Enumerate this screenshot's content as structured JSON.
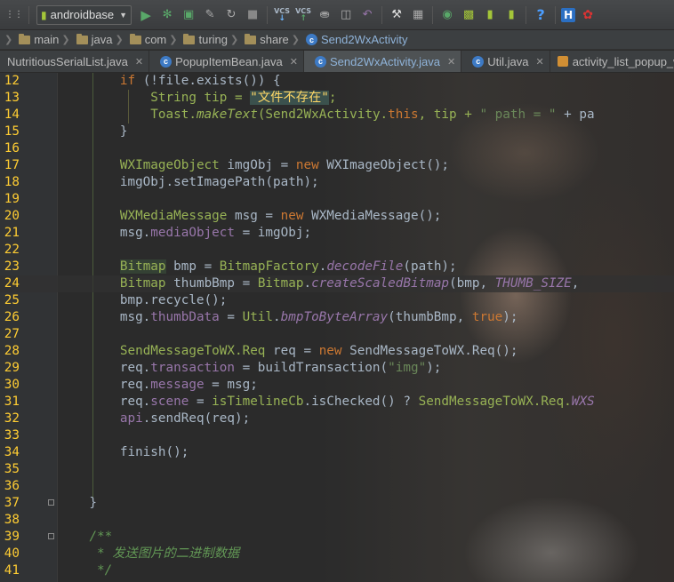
{
  "toolbar": {
    "config_name": "androidbase",
    "vcs_label_1": "VCS",
    "vcs_label_2": "VCS"
  },
  "breadcrumb": [
    "main",
    "java",
    "com",
    "turing",
    "share",
    "Send2WxActivity"
  ],
  "tabs": [
    {
      "label": "NutritiousSerialList.java",
      "active": false,
      "icon": "class-icon"
    },
    {
      "label": "PopupItemBean.java",
      "active": false,
      "icon": "class-icon"
    },
    {
      "label": "Send2WxActivity.java",
      "active": true,
      "icon": "class-icon"
    },
    {
      "label": "Util.java",
      "active": false,
      "icon": "class-icon"
    },
    {
      "label": "activity_list_popup_win",
      "active": false,
      "icon": "xml-layout-icon"
    }
  ],
  "editor": {
    "current_line": "24",
    "lines": [
      {
        "n": "12",
        "tokens": [
          [
            "        ",
            ""
          ],
          [
            "if",
            "k"
          ],
          [
            " (!file.exists()) {",
            ""
          ]
        ]
      },
      {
        "n": "13",
        "tokens": [
          [
            "            ",
            ""
          ],
          [
            "String",
            "g"
          ],
          [
            " tip = ",
            "g"
          ],
          [
            "\"文件不存在\"",
            "sh"
          ],
          [
            ";",
            "g"
          ]
        ]
      },
      {
        "n": "14",
        "tokens": [
          [
            "            ",
            ""
          ],
          [
            "Toast.",
            "g"
          ],
          [
            "makeText",
            "g it"
          ],
          [
            "(Send2WxActivity.",
            "g"
          ],
          [
            "this",
            "k"
          ],
          [
            ", tip + ",
            "g"
          ],
          [
            "\" path = \"",
            "s"
          ],
          [
            " + pa",
            ""
          ]
        ]
      },
      {
        "n": "15",
        "tokens": [
          [
            "        }",
            ""
          ]
        ]
      },
      {
        "n": "16",
        "tokens": [
          [
            "",
            ""
          ]
        ]
      },
      {
        "n": "17",
        "tokens": [
          [
            "        ",
            ""
          ],
          [
            "WXImageObject",
            "g"
          ],
          [
            " imgObj = ",
            ""
          ],
          [
            "new",
            "k"
          ],
          [
            " WXImageObject();",
            ""
          ]
        ]
      },
      {
        "n": "18",
        "tokens": [
          [
            "        imgObj.setImagePath(path);",
            ""
          ]
        ]
      },
      {
        "n": "19",
        "tokens": [
          [
            "",
            ""
          ]
        ]
      },
      {
        "n": "20",
        "tokens": [
          [
            "        ",
            ""
          ],
          [
            "WXMediaMessage",
            "g"
          ],
          [
            " msg = ",
            ""
          ],
          [
            "new",
            "k"
          ],
          [
            " WXMediaMessage();",
            ""
          ]
        ]
      },
      {
        "n": "21",
        "tokens": [
          [
            "        msg.",
            ""
          ],
          [
            "mediaObject",
            "p"
          ],
          [
            " = imgObj;",
            ""
          ]
        ]
      },
      {
        "n": "22",
        "tokens": [
          [
            "",
            ""
          ]
        ]
      },
      {
        "n": "23",
        "tokens": [
          [
            "        ",
            ""
          ],
          [
            "Bitmap",
            "g hl"
          ],
          [
            " bmp = ",
            ""
          ],
          [
            "BitmapFactory",
            "g"
          ],
          [
            ".",
            ""
          ],
          [
            "decodeFile",
            "pu it"
          ],
          [
            "(path);",
            ""
          ]
        ]
      },
      {
        "n": "24",
        "tokens": [
          [
            "        ",
            ""
          ],
          [
            "Bitmap",
            "g"
          ],
          [
            " thumbBmp = ",
            ""
          ],
          [
            "Bitmap",
            "g"
          ],
          [
            ".",
            ""
          ],
          [
            "createScaledBitmap",
            "pu it"
          ],
          [
            "(bmp, ",
            ""
          ],
          [
            "THUMB_SIZE",
            "pu it"
          ],
          [
            ",",
            ""
          ]
        ]
      },
      {
        "n": "25",
        "tokens": [
          [
            "        bmp.recycle();",
            ""
          ]
        ]
      },
      {
        "n": "26",
        "tokens": [
          [
            "        msg.",
            ""
          ],
          [
            "thumbData",
            "p"
          ],
          [
            " = ",
            ""
          ],
          [
            "Util",
            "g"
          ],
          [
            ".",
            ""
          ],
          [
            "bmpToByteArray",
            "pu it"
          ],
          [
            "(thumbBmp, ",
            ""
          ],
          [
            "true",
            "k"
          ],
          [
            ");",
            ""
          ]
        ]
      },
      {
        "n": "27",
        "tokens": [
          [
            "",
            ""
          ]
        ]
      },
      {
        "n": "28",
        "tokens": [
          [
            "        ",
            ""
          ],
          [
            "SendMessageToWX.Req",
            "g"
          ],
          [
            " req = ",
            ""
          ],
          [
            "new",
            "k"
          ],
          [
            " SendMessageToWX.Req();",
            ""
          ]
        ]
      },
      {
        "n": "29",
        "tokens": [
          [
            "        req.",
            ""
          ],
          [
            "transaction",
            "p"
          ],
          [
            " = buildTransaction(",
            ""
          ],
          [
            "\"img\"",
            "s"
          ],
          [
            ");",
            ""
          ]
        ]
      },
      {
        "n": "30",
        "tokens": [
          [
            "        req.",
            ""
          ],
          [
            "message",
            "p"
          ],
          [
            " = msg;",
            ""
          ]
        ]
      },
      {
        "n": "31",
        "tokens": [
          [
            "        req.",
            ""
          ],
          [
            "scene",
            "p"
          ],
          [
            " = ",
            ""
          ],
          [
            "isTimelineCb",
            "g"
          ],
          [
            ".isChecked() ? ",
            ""
          ],
          [
            "SendMessageToWX.Req.",
            "g"
          ],
          [
            "WXS",
            "pu it"
          ]
        ]
      },
      {
        "n": "32",
        "tokens": [
          [
            "        ",
            ""
          ],
          [
            "api",
            "p"
          ],
          [
            ".sendReq(req);",
            ""
          ]
        ]
      },
      {
        "n": "33",
        "tokens": [
          [
            "",
            ""
          ]
        ]
      },
      {
        "n": "34",
        "tokens": [
          [
            "        finish();",
            ""
          ]
        ]
      },
      {
        "n": "35",
        "tokens": [
          [
            "",
            ""
          ]
        ]
      },
      {
        "n": "36",
        "tokens": [
          [
            "",
            ""
          ]
        ]
      },
      {
        "n": "37",
        "tokens": [
          [
            "    }",
            ""
          ]
        ]
      },
      {
        "n": "38",
        "tokens": [
          [
            "",
            ""
          ]
        ]
      },
      {
        "n": "39",
        "tokens": [
          [
            "    ",
            ""
          ],
          [
            "/**",
            "doc"
          ]
        ]
      },
      {
        "n": "40",
        "tokens": [
          [
            "     ",
            ""
          ],
          [
            "* 发送图片的二进制数据",
            "doc"
          ]
        ]
      },
      {
        "n": "41",
        "tokens": [
          [
            "     ",
            ""
          ],
          [
            "*/",
            "doc"
          ]
        ]
      }
    ]
  },
  "colors": {
    "background": "#2b2b2b",
    "gutter": "#313335",
    "line_number": "#ffcd33",
    "keyword": "#cc7832",
    "string": "#6a8759",
    "field": "#9876aa"
  }
}
